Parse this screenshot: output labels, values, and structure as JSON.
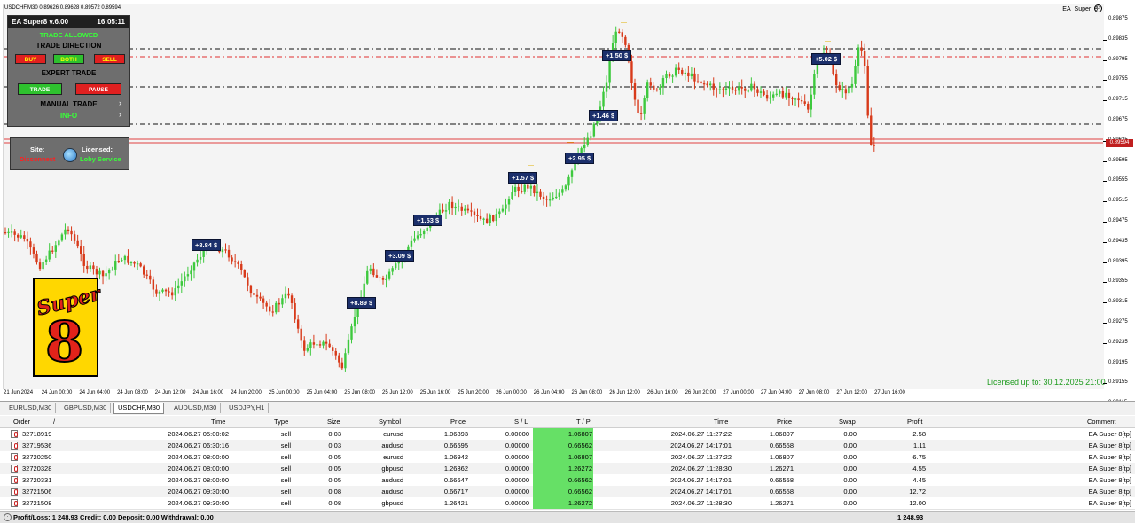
{
  "chart": {
    "symbol_label": "USDCHF,M30  0.89626 0.89628 0.89572 0.89594",
    "ea_name": "EA_Super_8",
    "ea_icon": "smiley-icon",
    "licensed": "Licensed up to: 30.12.2025  21:00",
    "current_price": "0.89594",
    "price_labels": [
      "0.89875",
      "0.89795",
      "0.89715",
      "0.89635",
      "0.89555",
      "0.89475",
      "0.89395",
      "0.89315",
      "0.89235",
      "0.89155",
      "0.89115"
    ],
    "price_axis": [
      "0.89875",
      "0.89835",
      "0.89795",
      "0.89755",
      "0.89715",
      "0.89675",
      "0.89635",
      "0.89595",
      "0.89555",
      "0.89515",
      "0.89475",
      "0.89435",
      "0.89395",
      "0.89355",
      "0.89315",
      "0.89275",
      "0.89235",
      "0.89195",
      "0.89155",
      "0.89115"
    ],
    "time_labels": [
      "21 Jun 2024",
      "24 Jun 00:00",
      "24 Jun 04:00",
      "24 Jun 08:00",
      "24 Jun 12:00",
      "24 Jun 16:00",
      "24 Jun 20:00",
      "25 Jun 00:00",
      "25 Jun 04:00",
      "25 Jun 08:00",
      "25 Jun 12:00",
      "25 Jun 16:00",
      "25 Jun 20:00",
      "26 Jun 00:00",
      "26 Jun 04:00",
      "26 Jun 08:00",
      "26 Jun 12:00",
      "26 Jun 16:00",
      "26 Jun 20:00",
      "27 Jun 00:00",
      "27 Jun 04:00",
      "27 Jun 08:00",
      "27 Jun 12:00",
      "27 Jun 16:00"
    ],
    "profit_labels": [
      "+8.84 $",
      "+8.89 $",
      "+3.09 $",
      "+1.53 $",
      "+1.57 $",
      "+2.95 $",
      "+1.46 $",
      "+1.50 $",
      "+5.02 $"
    ],
    "colors": {
      "bull": "#3ec93e",
      "bear": "#d83a1a",
      "dash_black": "#111111",
      "dash_red": "#e03030",
      "price_line": "#e04040"
    }
  },
  "ea_panel": {
    "title": "EA Super8 v.6.00",
    "time": "16:05:11",
    "trade_allowed": "TRADE ALLOWED",
    "trade_direction": "TRADE DIRECTION",
    "buy": "BUY",
    "both": "BOTH",
    "sell": "SELL",
    "expert_trade": "EXPERT TRADE",
    "trade": "TRADE",
    "pause": "PAUSE",
    "manual_trade": "MANUAL TRADE",
    "info": "INFO",
    "site_label": "Site:",
    "site_value": "Disconnect",
    "licensed_label": "Licensed:",
    "licensed_value": "Loby Service"
  },
  "logo": {
    "top": "Super",
    "bottom": "8"
  },
  "tabs": [
    {
      "label": "EURUSD,M30"
    },
    {
      "label": "GBPUSD,M30"
    },
    {
      "label": "USDCHF,M30"
    },
    {
      "label": "AUDUSD,M30"
    },
    {
      "label": "USDJPY,H1"
    }
  ],
  "table": {
    "headers": {
      "order": "Order",
      "sort": "/",
      "time": "Time",
      "type": "Type",
      "size": "Size",
      "symbol": "Symbol",
      "price": "Price",
      "sl": "S / L",
      "tp": "T / P",
      "close_time": "Time",
      "close_price": "Price",
      "swap": "Swap",
      "profit": "Profit",
      "comment": "Comment"
    },
    "rows": [
      {
        "order": "32718919",
        "time": "2024.06.27 05:00:02",
        "type": "sell",
        "size": "0.03",
        "symbol": "eurusd",
        "price": "1.06893",
        "sl": "0.00000",
        "tp": "1.06807",
        "close_time": "2024.06.27 11:27:22",
        "close_price": "1.06807",
        "swap": "0.00",
        "profit": "2.58",
        "comment": "EA Super 8[tp]"
      },
      {
        "order": "32719536",
        "time": "2024.06.27 06:30:16",
        "type": "sell",
        "size": "0.03",
        "symbol": "audusd",
        "price": "0.66595",
        "sl": "0.00000",
        "tp": "0.66562",
        "close_time": "2024.06.27 14:17:01",
        "close_price": "0.66558",
        "swap": "0.00",
        "profit": "1.11",
        "comment": "EA Super 8[tp]"
      },
      {
        "order": "32720250",
        "time": "2024.06.27 08:00:00",
        "type": "sell",
        "size": "0.05",
        "symbol": "eurusd",
        "price": "1.06942",
        "sl": "0.00000",
        "tp": "1.06807",
        "close_time": "2024.06.27 11:27:22",
        "close_price": "1.06807",
        "swap": "0.00",
        "profit": "6.75",
        "comment": "EA Super 8[tp]"
      },
      {
        "order": "32720328",
        "time": "2024.06.27 08:00:00",
        "type": "sell",
        "size": "0.05",
        "symbol": "gbpusd",
        "price": "1.26362",
        "sl": "0.00000",
        "tp": "1.26272",
        "close_time": "2024.06.27 11:28:30",
        "close_price": "1.26271",
        "swap": "0.00",
        "profit": "4.55",
        "comment": "EA Super 8[tp]"
      },
      {
        "order": "32720331",
        "time": "2024.06.27 08:00:00",
        "type": "sell",
        "size": "0.05",
        "symbol": "audusd",
        "price": "0.66647",
        "sl": "0.00000",
        "tp": "0.66562",
        "close_time": "2024.06.27 14:17:01",
        "close_price": "0.66558",
        "swap": "0.00",
        "profit": "4.45",
        "comment": "EA Super 8[tp]"
      },
      {
        "order": "32721506",
        "time": "2024.06.27 09:30:00",
        "type": "sell",
        "size": "0.08",
        "symbol": "audusd",
        "price": "0.66717",
        "sl": "0.00000",
        "tp": "0.66562",
        "close_time": "2024.06.27 14:17:01",
        "close_price": "0.66558",
        "swap": "0.00",
        "profit": "12.72",
        "comment": "EA Super 8[tp]"
      },
      {
        "order": "32721508",
        "time": "2024.06.27 09:30:00",
        "type": "sell",
        "size": "0.08",
        "symbol": "gbpusd",
        "price": "1.26421",
        "sl": "0.00000",
        "tp": "1.26272",
        "close_time": "2024.06.27 11:28:30",
        "close_price": "1.26271",
        "swap": "0.00",
        "profit": "12.00",
        "comment": "EA Super 8[tp]"
      }
    ],
    "summary": "Profit/Loss: 1 248.93  Credit: 0.00  Deposit: 0.00  Withdrawal: 0.00",
    "summary_total": "1 248.93"
  }
}
